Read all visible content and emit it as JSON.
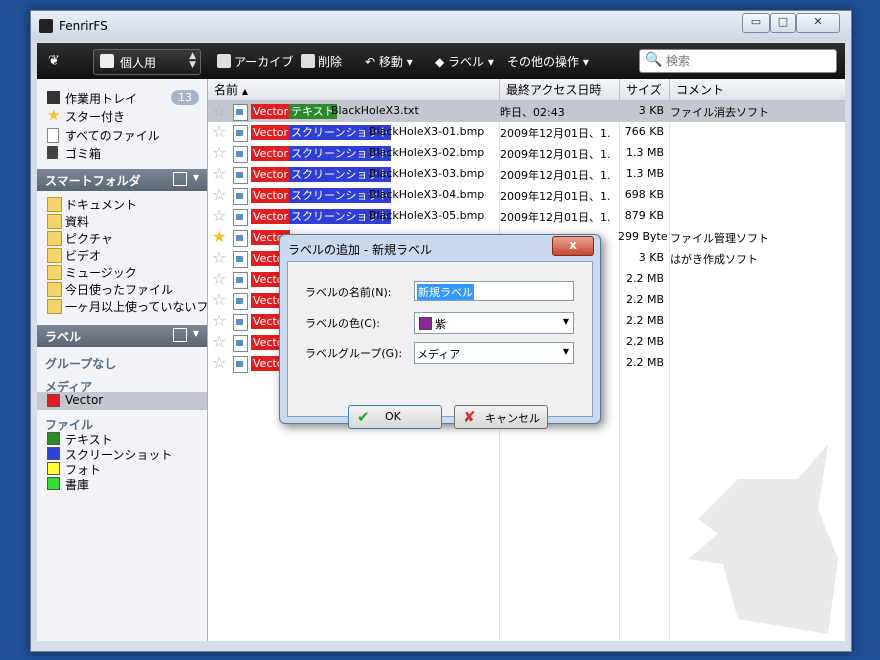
{
  "window": {
    "title": "FenrirFS",
    "minimize": "▭",
    "maximize": "□",
    "close": "✕"
  },
  "toolbar": {
    "profile_label": "個人用",
    "buttons": [
      "アーカイブ",
      "削除",
      "移動",
      "ラベル",
      "その他の操作"
    ],
    "search_placeholder": "検索"
  },
  "sidebar": {
    "top_items": [
      {
        "label": "作業用トレイ",
        "count": "13",
        "icon": "tray-icon"
      },
      {
        "label": "スター付き",
        "icon": "star-icon"
      },
      {
        "label": "すべてのファイル",
        "icon": "file-icon"
      },
      {
        "label": "ゴミ箱",
        "icon": "trash-icon"
      }
    ],
    "smart_folder_header": "スマートフォルダ",
    "smart_folders": [
      "ドキュメント",
      "資料",
      "ピクチャ",
      "ビデオ",
      "ミュージック",
      "今日使ったファイル",
      "一ヶ月以上使っていないフ..."
    ],
    "label_header": "ラベル",
    "label_groups": [
      {
        "name": "グループなし",
        "labels": []
      },
      {
        "name": "メディア",
        "labels": [
          {
            "name": "Vector",
            "color": "#e02020"
          }
        ]
      },
      {
        "name": "ファイル",
        "labels": [
          {
            "name": "テキスト",
            "color": "#2c8a2c"
          },
          {
            "name": "スクリーンショット",
            "color": "#2f3fd6"
          },
          {
            "name": "フォト",
            "color": "#ffff33"
          },
          {
            "name": "書庫",
            "color": "#33dd33"
          }
        ]
      }
    ]
  },
  "file_list": {
    "columns": [
      "名前",
      "最終アクセス日時",
      "サイズ",
      "コメント"
    ],
    "sort_indicator": "▲",
    "rows": [
      {
        "starred": false,
        "labels": [
          "Vector",
          "テキスト"
        ],
        "name": "BlackHoleX3.txt",
        "date": "昨日、02:43",
        "size": "3 KB",
        "comment": "ファイル消去ソフト",
        "selected": true
      },
      {
        "starred": false,
        "labels": [
          "Vector",
          "スクリーンショット"
        ],
        "name": "BlackHoleX3-01.bmp",
        "date": "2009年12月01日、1...",
        "size": "766 KB",
        "comment": ""
      },
      {
        "starred": false,
        "labels": [
          "Vector",
          "スクリーンショット"
        ],
        "name": "BlackHoleX3-02.bmp",
        "date": "2009年12月01日、1...",
        "size": "1.3 MB",
        "comment": ""
      },
      {
        "starred": false,
        "labels": [
          "Vector",
          "スクリーンショット"
        ],
        "name": "BlackHoleX3-03.bmp",
        "date": "2009年12月01日、1...",
        "size": "1.3 MB",
        "comment": ""
      },
      {
        "starred": false,
        "labels": [
          "Vector",
          "スクリーンショット"
        ],
        "name": "BlackHoleX3-04.bmp",
        "date": "2009年12月01日、1...",
        "size": "698 KB",
        "comment": ""
      },
      {
        "starred": false,
        "labels": [
          "Vector",
          "スクリーンショット"
        ],
        "name": "BlackHoleX3-05.bmp",
        "date": "2009年12月01日、1...",
        "size": "879 KB",
        "comment": ""
      },
      {
        "starred": true,
        "labels": [
          "Vector"
        ],
        "name": "",
        "date": "",
        "size": "299 Byte",
        "comment": "ファイル管理ソフト"
      },
      {
        "starred": false,
        "labels": [
          "Vector"
        ],
        "name": "",
        "date": "",
        "size": "3 KB",
        "comment": "はがき作成ソフト"
      },
      {
        "starred": false,
        "labels": [
          "Vector"
        ],
        "name": "",
        "date": "",
        "size": "2.2 MB",
        "comment": ""
      },
      {
        "starred": false,
        "labels": [
          "Vector"
        ],
        "name": "",
        "date": "",
        "size": "2.2 MB",
        "comment": ""
      },
      {
        "starred": false,
        "labels": [
          "Vector"
        ],
        "name": "",
        "date": "",
        "size": "2.2 MB",
        "comment": ""
      },
      {
        "starred": false,
        "labels": [
          "Vector"
        ],
        "name": "",
        "date": "",
        "size": "2.2 MB",
        "comment": ""
      },
      {
        "starred": false,
        "labels": [
          "Vector"
        ],
        "name": "",
        "date": "",
        "size": "2.2 MB",
        "comment": ""
      }
    ]
  },
  "label_colors": {
    "Vector": "#e02020",
    "テキスト": "#2c8a2c",
    "スクリーンショット": "#2f3fd6"
  },
  "dialog": {
    "title": "ラベルの追加 - 新規ラベル",
    "close": "x",
    "name_label": "ラベルの名前(N):",
    "name_value": "新規ラベル",
    "color_label": "ラベルの色(C):",
    "color_value": "紫",
    "color_swatch": "#8a2a9a",
    "group_label": "ラベルグループ(G):",
    "group_value": "メディア",
    "ok": "OK",
    "cancel": "キャンセル"
  }
}
